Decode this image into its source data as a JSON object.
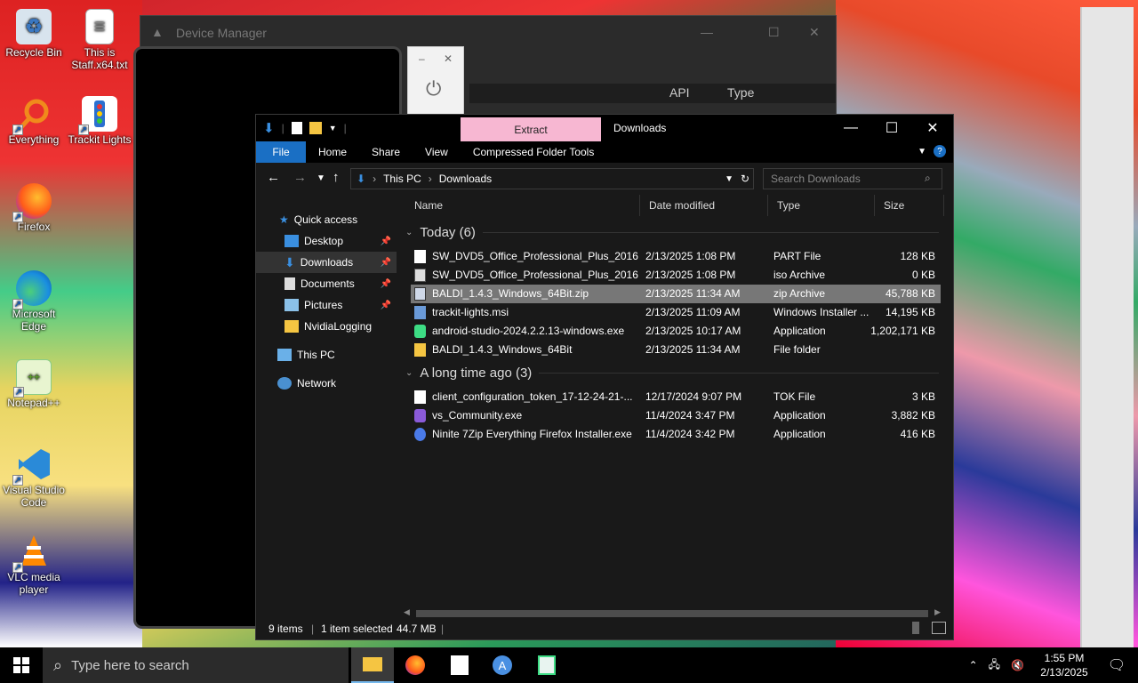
{
  "desktop": {
    "icons": [
      {
        "label": "Recycle Bin",
        "icon": "recycle-bin-icon"
      },
      {
        "label": "This is Staff.x64.txt",
        "icon": "text-file-icon"
      },
      {
        "label": "Everything",
        "icon": "everything-search-icon"
      },
      {
        "label": "Trackit Lights",
        "icon": "traffic-light-icon"
      },
      {
        "label": "Firefox",
        "icon": "firefox-icon"
      },
      {
        "label": "Microsoft Edge",
        "icon": "edge-icon"
      },
      {
        "label": "Notepad++",
        "icon": "notepadpp-icon"
      },
      {
        "label": "Visual Studio Code",
        "icon": "vscode-icon"
      },
      {
        "label": "VLC media player",
        "icon": "vlc-icon"
      }
    ]
  },
  "device_manager": {
    "title": "Device Manager",
    "columns": [
      "API",
      "Type"
    ]
  },
  "explorer": {
    "title": "Downloads",
    "context_tab": "Extract",
    "ribbon_tabs": [
      "File",
      "Home",
      "Share",
      "View",
      "Compressed Folder Tools"
    ],
    "breadcrumb": [
      "This PC",
      "Downloads"
    ],
    "search_placeholder": "Search Downloads",
    "nav": {
      "quick_access": "Quick access",
      "items": [
        "Desktop",
        "Downloads",
        "Documents",
        "Pictures",
        "NvidiaLogging"
      ],
      "this_pc": "This PC",
      "network": "Network"
    },
    "columns": {
      "name": "Name",
      "date": "Date modified",
      "type": "Type",
      "size": "Size"
    },
    "groups": [
      {
        "label": "Today (6)",
        "files": [
          {
            "name": "SW_DVD5_Office_Professional_Plus_2016...",
            "date": "2/13/2025 1:08 PM",
            "type": "PART File",
            "size": "128 KB",
            "icon": "part-file-icon"
          },
          {
            "name": "SW_DVD5_Office_Professional_Plus_2016...",
            "date": "2/13/2025 1:08 PM",
            "type": "iso Archive",
            "size": "0 KB",
            "icon": "iso-file-icon"
          },
          {
            "name": "BALDI_1.4.3_Windows_64Bit.zip",
            "date": "2/13/2025 11:34 AM",
            "type": "zip Archive",
            "size": "45,788 KB",
            "icon": "zip-file-icon",
            "selected": true
          },
          {
            "name": "trackit-lights.msi",
            "date": "2/13/2025 11:09 AM",
            "type": "Windows Installer ...",
            "size": "14,195 KB",
            "icon": "msi-file-icon"
          },
          {
            "name": "android-studio-2024.2.2.13-windows.exe",
            "date": "2/13/2025 10:17 AM",
            "type": "Application",
            "size": "1,202,171 KB",
            "icon": "android-studio-icon"
          },
          {
            "name": "BALDI_1.4.3_Windows_64Bit",
            "date": "2/13/2025 11:34 AM",
            "type": "File folder",
            "size": "",
            "icon": "folder-icon"
          }
        ]
      },
      {
        "label": "A long time ago (3)",
        "files": [
          {
            "name": "client_configuration_token_17-12-24-21-...",
            "date": "12/17/2024 9:07 PM",
            "type": "TOK File",
            "size": "3 KB",
            "icon": "blank-file-icon"
          },
          {
            "name": "vs_Community.exe",
            "date": "11/4/2024 3:47 PM",
            "type": "Application",
            "size": "3,882 KB",
            "icon": "visual-studio-icon"
          },
          {
            "name": "Ninite 7Zip Everything Firefox Installer.exe",
            "date": "11/4/2024 3:42 PM",
            "type": "Application",
            "size": "416 KB",
            "icon": "ninite-icon"
          }
        ]
      }
    ],
    "status": {
      "count": "9 items",
      "selected": "1 item selected",
      "size": "44.7 MB"
    }
  },
  "taskbar": {
    "search_placeholder": "Type here to search",
    "time": "1:55 PM",
    "date": "2/13/2025"
  }
}
